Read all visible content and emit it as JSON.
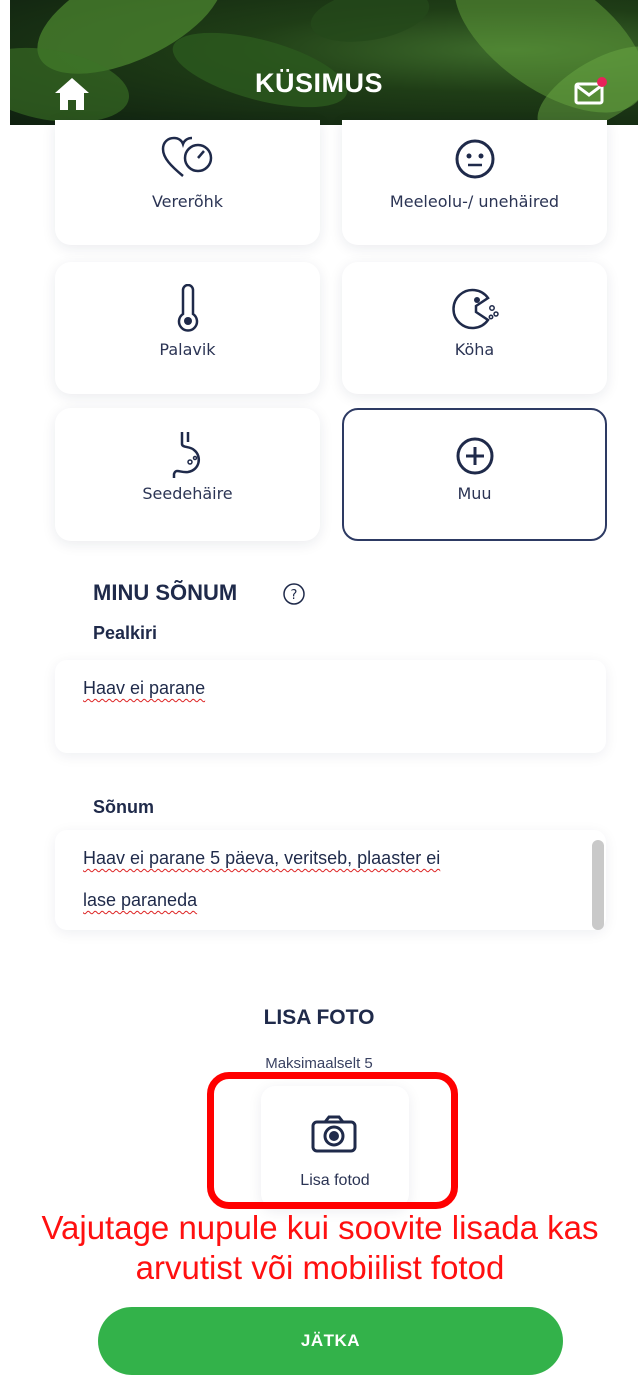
{
  "header": {
    "title": "KÜSIMUS",
    "home_icon": "home-icon",
    "mail_icon": "mail-icon",
    "notification_color": "#e8235a"
  },
  "categories": [
    {
      "label": "Vererõhk",
      "icon": "blood-pressure-heart-icon"
    },
    {
      "label": "Meeleolu-/ unehäired",
      "icon": "mood-face-icon"
    },
    {
      "label": "Palavik",
      "icon": "thermometer-icon"
    },
    {
      "label": "Köha",
      "icon": "cough-icon"
    },
    {
      "label": "Seedehäire",
      "icon": "stomach-icon"
    },
    {
      "label": "Muu",
      "icon": "plus-circle-icon",
      "selected": true
    }
  ],
  "message": {
    "section_title": "MINU SÕNUM",
    "title_label": "Pealkiri",
    "title_value": "Haav ei parane",
    "body_label": "Sõnum",
    "body_line1": "Haav ei parane 5 päeva, veritseb, plaaster ei",
    "body_line2": "lase paraneda"
  },
  "photo": {
    "title": "LISA FOTO",
    "subtitle": "Maksimaalselt 5",
    "button_label": "Lisa fotod"
  },
  "annotation": {
    "line1": "Vajutage nupule kui soovite lisada kas",
    "line2": "arvutist või  mobiilist fotod",
    "color": "#ff0000"
  },
  "continue_label": "JÄTKA",
  "colors": {
    "primary_text": "#1f2a4a",
    "button_green": "#33b24a"
  }
}
